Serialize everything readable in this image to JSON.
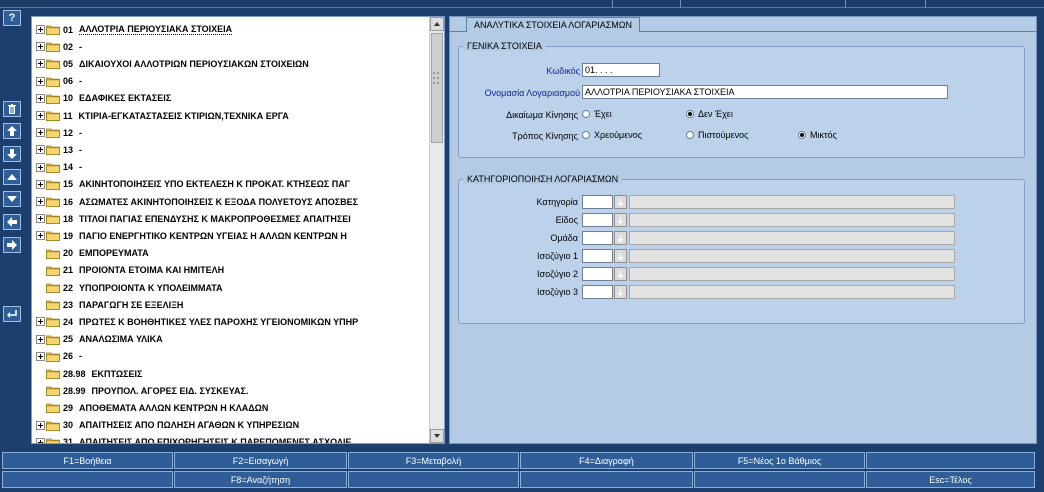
{
  "toolbar_left": {
    "items": [
      {
        "icon": "help-icon",
        "glyph": "?"
      },
      {
        "icon": "trash-icon"
      },
      {
        "icon": "arrow-up-icon"
      },
      {
        "icon": "arrow-down-icon"
      },
      {
        "icon": "triangle-up-icon"
      },
      {
        "icon": "triangle-down-icon"
      },
      {
        "icon": "arrow-left-icon"
      },
      {
        "icon": "arrow-right-icon"
      },
      {
        "icon": "return-icon"
      }
    ]
  },
  "tree": {
    "items": [
      {
        "code": "01",
        "name": "ΑΛΛΟΤΡΙΑ ΠΕΡΙΟΥΣΙΑΚΑ ΣΤΟΙΧΕΙΑ",
        "expandable": true,
        "selected": true
      },
      {
        "code": "02",
        "name": "-",
        "expandable": true
      },
      {
        "code": "05",
        "name": "ΔΙΚΑΙΟΥΧΟΙ ΑΛΛΟΤΡΙΩΝ ΠΕΡΙΟΥΣΙΑΚΩΝ ΣΤΟΙΧΕΙΩΝ",
        "expandable": true
      },
      {
        "code": "06",
        "name": "-",
        "expandable": true
      },
      {
        "code": "10",
        "name": "ΕΔΑΦΙΚΕΣ ΕΚΤΑΣΕΙΣ",
        "expandable": true
      },
      {
        "code": "11",
        "name": "ΚΤΙΡΙΑ-ΕΓΚΑΤΑΣΤΑΣΕΙΣ ΚΤΙΡΙΩΝ,ΤΕΧΝΙΚΑ ΕΡΓΑ",
        "expandable": true
      },
      {
        "code": "12",
        "name": "-",
        "expandable": true
      },
      {
        "code": "13",
        "name": "-",
        "expandable": true
      },
      {
        "code": "14",
        "name": "-",
        "expandable": true
      },
      {
        "code": "15",
        "name": "ΑΚΙΝΗΤΟΠΟΙΗΣΕΙΣ ΥΠΟ ΕΚΤΕΛΕΣΗ Κ ΠΡΟΚΑΤ. ΚΤΗΣΕΩΣ ΠΑΓ",
        "expandable": true
      },
      {
        "code": "16",
        "name": "ΑΣΩΜΑΤΕΣ ΑΚΙΝΗΤΟΠΟΙΗΣΕΙΣ Κ ΕΞΟΔΑ ΠΟΛΥΕΤΟΥΣ ΑΠΟΣΒΕΣ",
        "expandable": true
      },
      {
        "code": "18",
        "name": "ΤΙΤΛΟΙ ΠΑΓΙΑΣ ΕΠΕΝΔΥΣΗΣ Κ ΜΑΚΡΟΠΡΟΘΕΣΜΕΣ ΑΠΑΙΤΗΣΕΙ",
        "expandable": true
      },
      {
        "code": "19",
        "name": "ΠΑΓΙΟ ΕΝΕΡΓΗΤΙΚΟ ΚΕΝΤΡΩΝ ΥΓΕΙΑΣ Η ΑΛΛΩΝ ΚΕΝΤΡΩΝ Η",
        "expandable": true
      },
      {
        "code": "20",
        "name": "ΕΜΠΟΡΕΥΜΑΤΑ",
        "expandable": false
      },
      {
        "code": "21",
        "name": "ΠΡΟΙΟΝΤΑ ΕΤΟΙΜΑ ΚΑΙ ΗΜΙΤΕΛΗ",
        "expandable": false
      },
      {
        "code": "22",
        "name": "ΥΠΟΠΡΟΙΟΝΤΑ Κ ΥΠΟΛΕΙΜΜΑΤΑ",
        "expandable": false
      },
      {
        "code": "23",
        "name": "ΠΑΡΑΓΩΓΗ ΣΕ ΕΞΕΛΙΞΗ",
        "expandable": false
      },
      {
        "code": "24",
        "name": "ΠΡΩΤΕΣ Κ ΒΟΗΘΗΤΙΚΕΣ ΥΛΕΣ ΠΑΡΟΧΗΣ ΥΓΕΙΟΝΟΜΙΚΩΝ ΥΠΗΡ",
        "expandable": true
      },
      {
        "code": "25",
        "name": "ΑΝΑΛΩΣΙΜΑ ΥΛΙΚΑ",
        "expandable": true
      },
      {
        "code": "26",
        "name": "-",
        "expandable": true
      },
      {
        "code": "28.98",
        "name": "ΕΚΠΤΩΣΕΙΣ",
        "expandable": false
      },
      {
        "code": "28.99",
        "name": "ΠΡΟΥΠΟΛ. ΑΓΟΡΕΣ ΕΙΔ. ΣΥΣΚΕΥΑΣ.",
        "expandable": false
      },
      {
        "code": "29",
        "name": "ΑΠΟΘΕΜΑΤΑ ΑΛΛΩΝ ΚΕΝΤΡΩΝ Η ΚΛΑΔΩΝ",
        "expandable": false
      },
      {
        "code": "30",
        "name": "ΑΠΑΙΤΗΣΕΙΣ ΑΠΟ ΠΩΛΗΣΗ ΑΓΑΘΩΝ Κ ΥΠΗΡΕΣΙΩΝ",
        "expandable": true
      },
      {
        "code": "31",
        "name": "ΑΠΑΙΤΗΣΕΙΣ ΑΠΟ ΕΠΙΧΟΡΗΓΗΣΕΙΣ Κ ΠΑΡΕΠΟΜΕΝΕΣ ΑΣΧΟΛΙΕ",
        "expandable": true
      }
    ]
  },
  "detail": {
    "tab_title": "ΑΝΑΛΥΤΙΚΑ ΣΤΟΙΧΕΙΑ ΛΟΓΑΡΙΑΣΜΩΝ",
    "general": {
      "title": "ΓΕΝΙΚΑ ΣΤΟΙΧΕΙΑ",
      "code_label": "Κωδικός",
      "code_value": "01.  .  .  .",
      "name_label": "Ονομασία Λογαριασμού",
      "name_value": "ΑΛΛΟΤΡΙΑ ΠΕΡΙΟΥΣΙΑΚΑ ΣΤΟΙΧΕΙΑ",
      "movement_right_label": "Δικαίωμα Κίνησης",
      "movement_right_options": [
        {
          "label": "Έχει",
          "selected": false
        },
        {
          "label": "Δεν Έχει",
          "selected": true
        }
      ],
      "movement_type_label": "Τρόπος Κίνησης",
      "movement_type_options": [
        {
          "label": "Χρεούμενος",
          "selected": false
        },
        {
          "label": "Πιστούμενος",
          "selected": false
        },
        {
          "label": "Μικτός",
          "selected": true
        }
      ]
    },
    "classification": {
      "title": "ΚΑΤΗΓΟΡΙΟΠΟΙΗΣΗ ΛΟΓΑΡΙΑΣΜΩΝ",
      "rows": [
        {
          "label": "Κατηγορία"
        },
        {
          "label": "Είδος"
        },
        {
          "label": "Ομάδα"
        },
        {
          "label": "Ισοζύγιο 1"
        },
        {
          "label": "Ισοζύγιο 2"
        },
        {
          "label": "Ισοζύγιο 3"
        }
      ]
    }
  },
  "function_keys": {
    "row1": [
      "F1=Βοήθεια",
      "F2=Εισαγωγή",
      "F3=Μεταβολή",
      "F4=Διαγραφή",
      "F5=Νέος 1ο Βάθμιος",
      ""
    ],
    "row2": [
      "",
      "F8=Αναζήτηση",
      "",
      "",
      "",
      "Esc=Τέλος"
    ]
  },
  "colors": {
    "background": "#1c3f6e",
    "panel": "#b4cbe6",
    "button": "#2f5d97",
    "folder": "#e8c04a",
    "label_blue": "#0a2a9a"
  }
}
